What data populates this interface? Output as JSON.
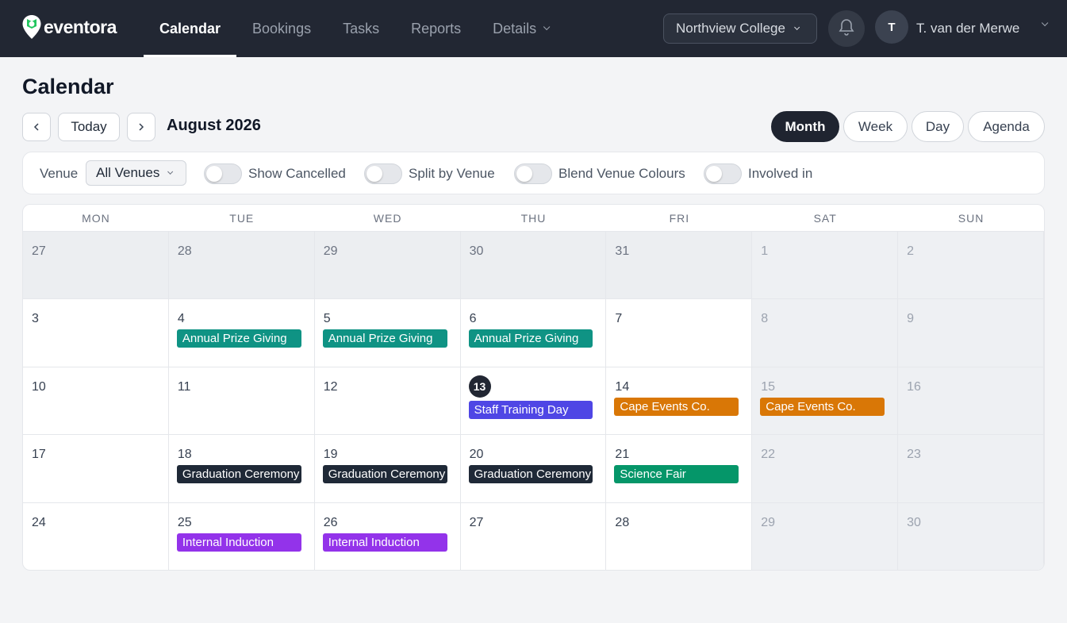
{
  "app": {
    "name": "eventora"
  },
  "nav": {
    "items": [
      {
        "label": "Calendar"
      },
      {
        "label": "Bookings"
      },
      {
        "label": "Tasks"
      },
      {
        "label": "Reports"
      },
      {
        "label": "Details"
      }
    ]
  },
  "org": {
    "selected": "Northview College"
  },
  "user": {
    "initial": "T",
    "name": "T. van der Merwe"
  },
  "page": {
    "title": "Calendar"
  },
  "toolbar": {
    "today_label": "Today",
    "month_label": "August 2026",
    "views": [
      "Month",
      "Week",
      "Day",
      "Agenda"
    ],
    "active_view": "Month"
  },
  "filters": {
    "venue_label": "Venue",
    "venue_value": "All Venues",
    "toggles": [
      {
        "label": "Show Cancelled",
        "on": false
      },
      {
        "label": "Split by Venue",
        "on": false
      },
      {
        "label": "Blend Venue Colours",
        "on": false
      },
      {
        "label": "Involved in",
        "on": false
      }
    ]
  },
  "calendar": {
    "weekdays": [
      "MON",
      "TUE",
      "WED",
      "THU",
      "FRI",
      "SAT",
      "SUN"
    ],
    "today": "13",
    "weeks": [
      [
        {
          "day": "27",
          "state": "prev"
        },
        {
          "day": "28",
          "state": "prev"
        },
        {
          "day": "29",
          "state": "prev"
        },
        {
          "day": "30",
          "state": "prev"
        },
        {
          "day": "31",
          "state": "prev"
        },
        {
          "day": "1",
          "state": "weekend"
        },
        {
          "day": "2",
          "state": "weekend"
        }
      ],
      [
        {
          "day": "3",
          "events": []
        },
        {
          "day": "4",
          "events": [
            {
              "title": "Annual Prize Giving",
              "color": "#0f9384"
            }
          ]
        },
        {
          "day": "5",
          "events": [
            {
              "title": "Annual Prize Giving",
              "color": "#0f9384"
            }
          ]
        },
        {
          "day": "6",
          "events": [
            {
              "title": "Annual Prize Giving",
              "color": "#0f9384"
            }
          ]
        },
        {
          "day": "7",
          "events": []
        },
        {
          "day": "8",
          "state": "weekend"
        },
        {
          "day": "9",
          "state": "weekend"
        }
      ],
      [
        {
          "day": "10",
          "events": []
        },
        {
          "day": "11",
          "events": []
        },
        {
          "day": "12",
          "events": []
        },
        {
          "day": "13",
          "today": true,
          "events": [
            {
              "title": "Staff Training Day",
              "color": "#4f46e5"
            }
          ]
        },
        {
          "day": "14",
          "events": [
            {
              "title": "Cape Events Co.",
              "color": "#d97706"
            }
          ]
        },
        {
          "day": "15",
          "state": "weekend",
          "events": [
            {
              "title": "Cape Events Co.",
              "color": "#d97706"
            }
          ]
        },
        {
          "day": "16",
          "state": "weekend"
        }
      ],
      [
        {
          "day": "17",
          "events": []
        },
        {
          "day": "18",
          "events": [
            {
              "title": "Graduation Ceremony",
              "color": "#1f2937"
            }
          ]
        },
        {
          "day": "19",
          "events": [
            {
              "title": "Graduation Ceremony",
              "color": "#1f2937"
            }
          ]
        },
        {
          "day": "20",
          "events": [
            {
              "title": "Graduation Ceremony",
              "color": "#1f2937"
            }
          ]
        },
        {
          "day": "21",
          "events": [
            {
              "title": "Science Fair",
              "color": "#059669"
            }
          ]
        },
        {
          "day": "22",
          "state": "weekend"
        },
        {
          "day": "23",
          "state": "weekend"
        }
      ],
      [
        {
          "day": "24",
          "events": []
        },
        {
          "day": "25",
          "events": [
            {
              "title": "Internal Induction",
              "color": "#9333ea"
            }
          ]
        },
        {
          "day": "26",
          "events": [
            {
              "title": "Internal Induction",
              "color": "#9333ea"
            }
          ]
        },
        {
          "day": "27",
          "events": []
        },
        {
          "day": "28",
          "events": []
        },
        {
          "day": "29",
          "state": "weekend"
        },
        {
          "day": "30",
          "state": "weekend"
        }
      ]
    ]
  },
  "colors": {
    "topbar": "#222733",
    "accent": "#10b981"
  }
}
